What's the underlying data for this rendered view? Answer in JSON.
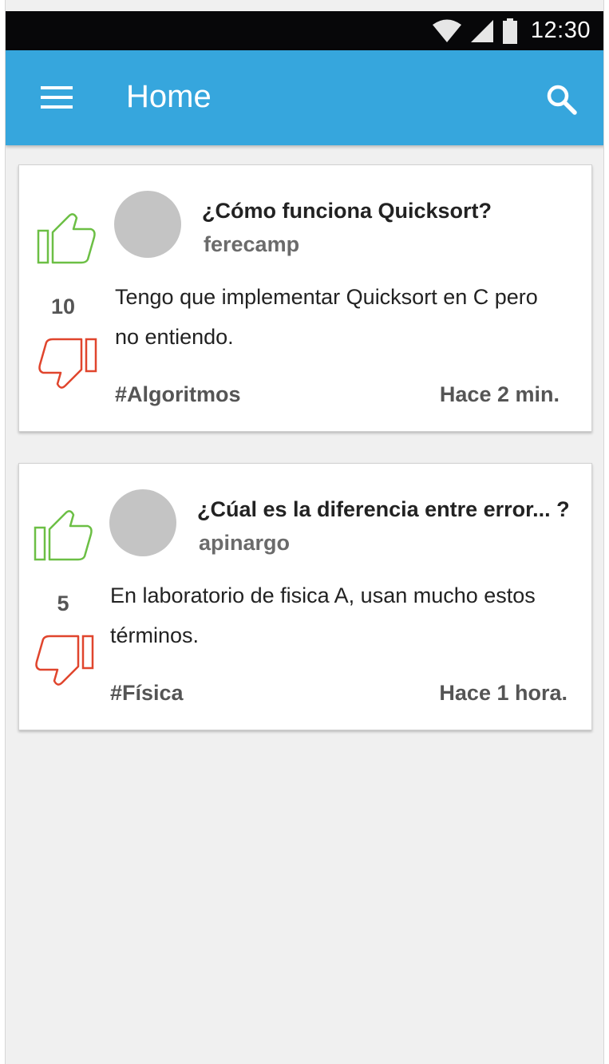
{
  "status_bar": {
    "time": "12:30",
    "icons": [
      "wifi-icon",
      "cell-signal-icon",
      "battery-icon"
    ]
  },
  "app_bar": {
    "title": "Home",
    "menu_icon": "hamburger-menu-icon",
    "search_icon": "search-icon",
    "color": "#36a6dd"
  },
  "colors": {
    "upvote": "#6cbf45",
    "downvote": "#e0452d",
    "avatar": "#c4c4c4"
  },
  "posts": [
    {
      "title": "¿Cómo funciona Quicksort?",
      "author": "ferecamp",
      "score": "10",
      "body_line1": "Tengo que implementar Quicksort en C pero",
      "body_line2": "no entiendo.",
      "tag": "#Algoritmos",
      "time": "Hace 2 min."
    },
    {
      "title": "¿Cúal es la diferencia entre error... ?",
      "author": "apinargo",
      "score": "5",
      "body_line1": "En laboratorio de fisica A, usan mucho estos",
      "body_line2": "términos.",
      "tag": "#Física",
      "time": "Hace 1 hora."
    }
  ]
}
